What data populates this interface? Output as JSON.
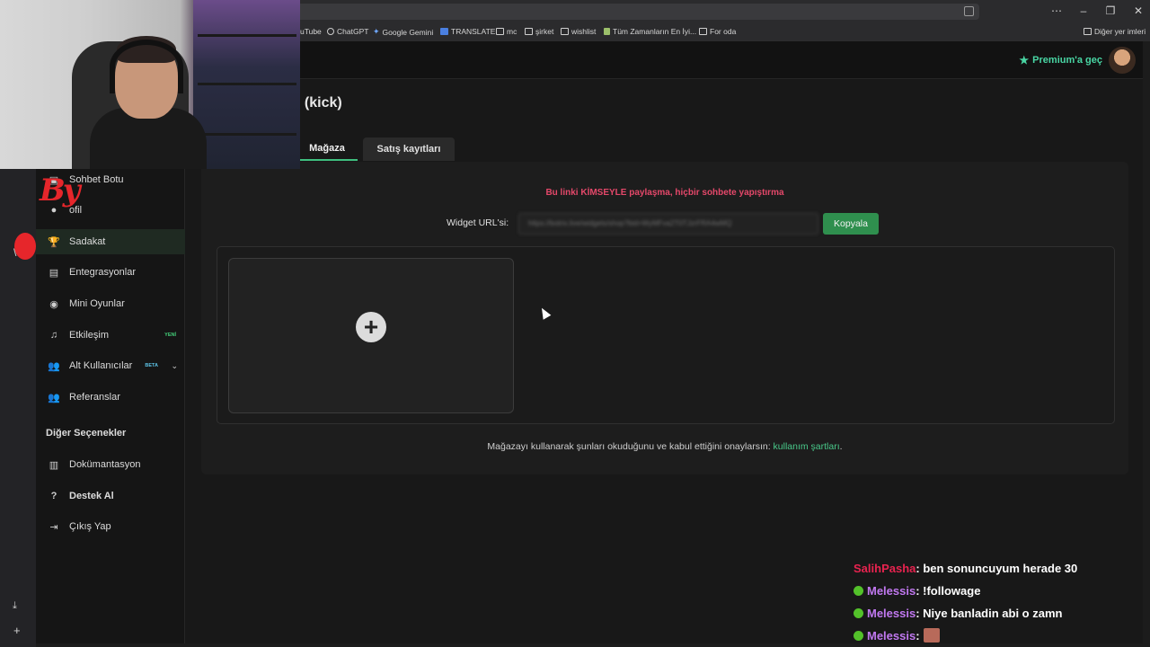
{
  "browser": {
    "bookmarks": [
      {
        "label": "uTube",
        "icon": "youtube-icon"
      },
      {
        "label": "ChatGPT",
        "icon": "chatgpt-icon"
      },
      {
        "label": "Google Gemini",
        "icon": "gemini-icon"
      },
      {
        "label": "TRANSLATE",
        "icon": "translate-icon"
      },
      {
        "label": "mc",
        "icon": "folder-icon"
      },
      {
        "label": "şirket",
        "icon": "folder-icon"
      },
      {
        "label": "wishlist",
        "icon": "folder-icon"
      },
      {
        "label": "Tüm Zamanların En İyi...",
        "icon": "page-icon"
      },
      {
        "label": "For oda",
        "icon": "folder-icon"
      }
    ],
    "other_bookmarks": "Diğer yer imleri",
    "window_controls": [
      "⋯",
      "–",
      "❐",
      "✕"
    ]
  },
  "header": {
    "premium_label": "Premium'a geç"
  },
  "page": {
    "title": "i (kick)"
  },
  "sidebar": {
    "items": [
      {
        "label": "Sohbet Botu",
        "icon": "bot-icon"
      },
      {
        "label": "ofil",
        "icon": "user-icon"
      },
      {
        "label": "Sadakat",
        "icon": "trophy-icon",
        "active": true
      },
      {
        "label": "Entegrasyonlar",
        "icon": "plug-icon"
      },
      {
        "label": "Mini Oyunlar",
        "icon": "gamepad-icon"
      },
      {
        "label": "Etkileşim",
        "icon": "music-icon",
        "badge": "YENİ"
      },
      {
        "label": "Alt Kullanıcılar",
        "icon": "users-icon",
        "badge": "BETA"
      },
      {
        "label": "Referanslar",
        "icon": "people-icon"
      }
    ],
    "section_title": "Diğer Seçenekler",
    "other_items": [
      {
        "label": "Dokümantasyon",
        "icon": "book-icon"
      },
      {
        "label": "Destek Al",
        "icon": "question-icon",
        "bold": true
      },
      {
        "label": "Çıkış Yap",
        "icon": "logout-icon"
      }
    ]
  },
  "tabs": {
    "magaza": "Mağaza",
    "satis": "Satış kayıtları"
  },
  "store": {
    "warning": "Bu linki KİMSEYLE paylaşma, hiçbir sohbete yapıştırma",
    "widget_label": "Widget URL'si:",
    "widget_url": "https://botrix.live/widgets/shop?bid=WyMFva2T0TJzrFRA4wMQ",
    "copy_label": "Kopyala",
    "terms_prefix": "Mağazayı kullanarak şunları okuduğunu ve kabul ettiğini onaylarsın: ",
    "terms_link": "kullanım şartları",
    "terms_suffix": "."
  },
  "overlay": {
    "logo_text": "By",
    "chat": [
      {
        "user": "SalihPasha",
        "message": " : ben sonuncuyum herade 30",
        "color": "#e8234f",
        "kick": false
      },
      {
        "user": "Melessis",
        "message": " : !followage",
        "color": "#c178f0",
        "kick": true
      },
      {
        "user": "Melessis",
        "message": " : Niye banladin abi o zamn",
        "color": "#c178f0",
        "kick": true
      },
      {
        "user": "Melessis",
        "message": " :",
        "color": "#c178f0",
        "kick": true,
        "emote": true
      }
    ]
  },
  "colors": {
    "accent": "#3fbf7f",
    "warning": "#e5486a",
    "copy_button": "#2f8f4e"
  }
}
